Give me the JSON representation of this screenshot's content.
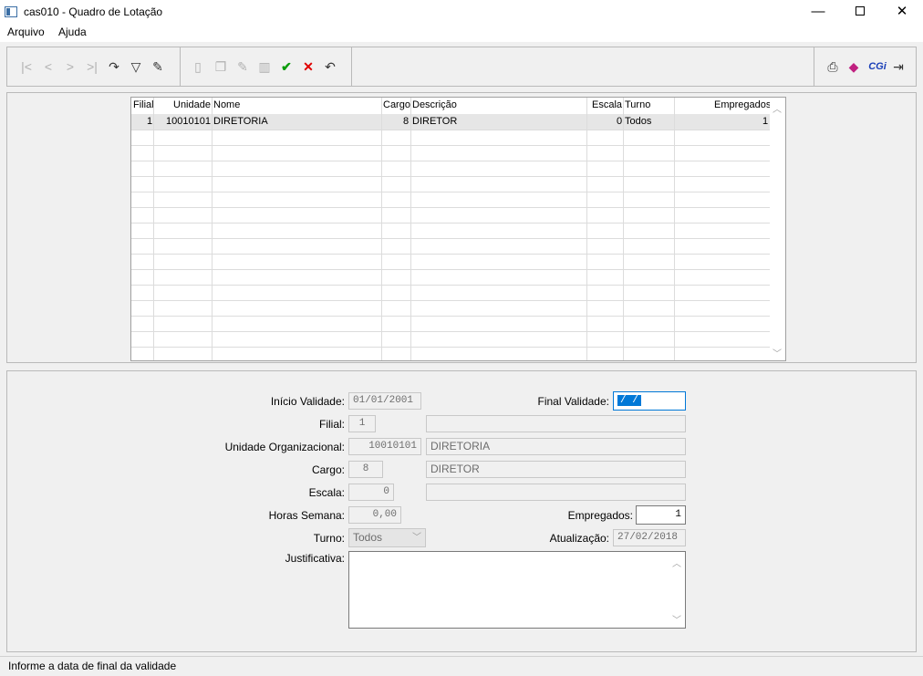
{
  "window": {
    "title": "cas010 - Quadro de Lotação",
    "minimize": "—",
    "close": "✕"
  },
  "menu": {
    "items": [
      "Arquivo",
      "Ajuda"
    ]
  },
  "toolbar": {
    "nav": [
      "first-icon",
      "previous-icon",
      "next-icon",
      "last-icon",
      "refresh-icon",
      "filter-icon",
      "search-icon"
    ],
    "edit": [
      "new-icon",
      "copy-icon",
      "edit-icon",
      "delete-icon",
      "confirm-icon",
      "cancel-icon",
      "undo-icon"
    ],
    "right": [
      "print-icon",
      "book-icon",
      "cgi-icon",
      "exit-icon"
    ],
    "cgi_label": "CGi"
  },
  "grid": {
    "columns": [
      "Filial",
      "Unidade",
      "Nome",
      "Cargo",
      "Descrição",
      "Escala",
      "Turno",
      "Empregados"
    ],
    "rows": [
      [
        "1",
        "10010101",
        "DIRETORIA",
        "8",
        "DIRETOR",
        "0",
        "Todos",
        "1"
      ]
    ]
  },
  "form": {
    "inicio_validade_label": "Início Validade:",
    "inicio_validade": "01/01/2001",
    "final_validade_label": "Final Validade:",
    "final_validade": " /  /",
    "filial_label": "Filial:",
    "filial": "1",
    "filial_desc": "",
    "unidade_label": "Unidade Organizacional:",
    "unidade": "10010101",
    "unidade_desc": "DIRETORIA",
    "cargo_label": "Cargo:",
    "cargo": "8",
    "cargo_desc": "DIRETOR",
    "escala_label": "Escala:",
    "escala": "0",
    "escala_desc": "",
    "horas_label": "Horas Semana:",
    "horas": "0,00",
    "empregados_label": "Empregados:",
    "empregados": "1",
    "turno_label": "Turno:",
    "turno": "Todos",
    "atualizacao_label": "Atualização:",
    "atualizacao": "27/02/2018",
    "justificativa_label": "Justificativa:",
    "justificativa": ""
  },
  "status": {
    "text": "Informe a data de final da validade"
  }
}
